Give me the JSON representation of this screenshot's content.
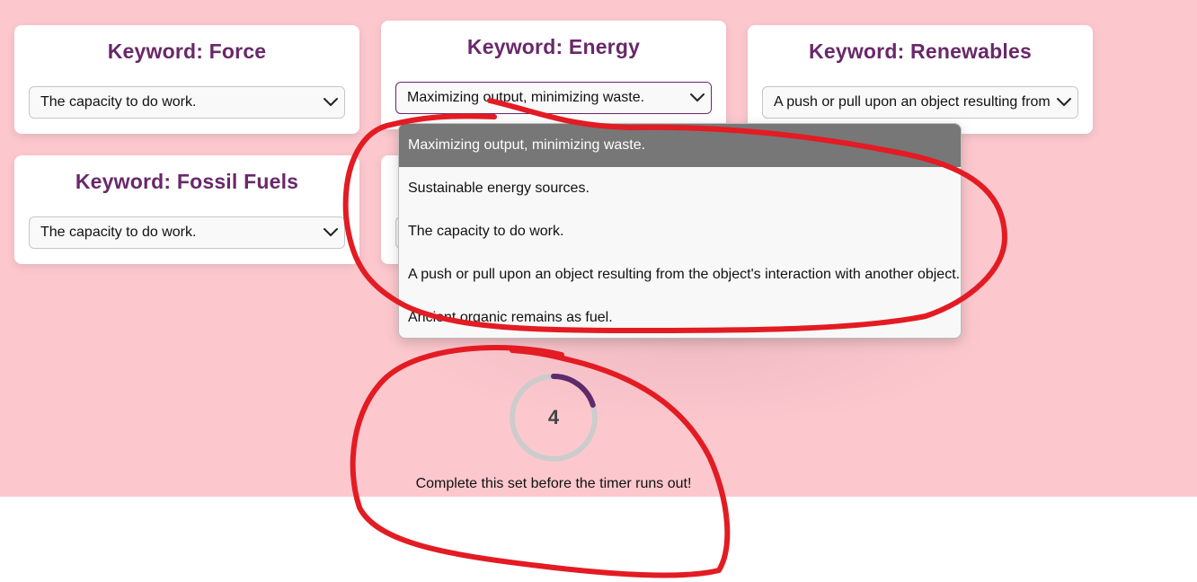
{
  "cards": [
    {
      "keyword": "Keyword: Force",
      "selected": "The capacity to do work."
    },
    {
      "keyword": "Keyword: Energy",
      "selected": "Maximizing output, minimizing waste."
    },
    {
      "keyword": "Keyword: Renewables",
      "selected": "A push or pull upon an object resulting from the object's interaction with another object."
    },
    {
      "keyword": "Keyword: Fossil Fuels",
      "selected": "The capacity to do work."
    }
  ],
  "dropdown": {
    "options": [
      "Maximizing output, minimizing waste.",
      "Sustainable energy sources.",
      "The capacity to do work.",
      "A push or pull upon an object resulting from the object's interaction with another object.",
      "Ancient organic remains as fuel."
    ],
    "selected_index": 0
  },
  "timer": {
    "value": "4",
    "progress_fraction": 0.2,
    "message": "Complete this set before the timer runs out!"
  },
  "colors": {
    "page_background": "#fcc8ce",
    "keyword_text": "#69286a",
    "timer_progress": "#5e2a6b",
    "timer_track": "#cccccc",
    "annotation": "#e31b23"
  },
  "icons": {
    "select_toggle": "chevron-down-icon"
  }
}
